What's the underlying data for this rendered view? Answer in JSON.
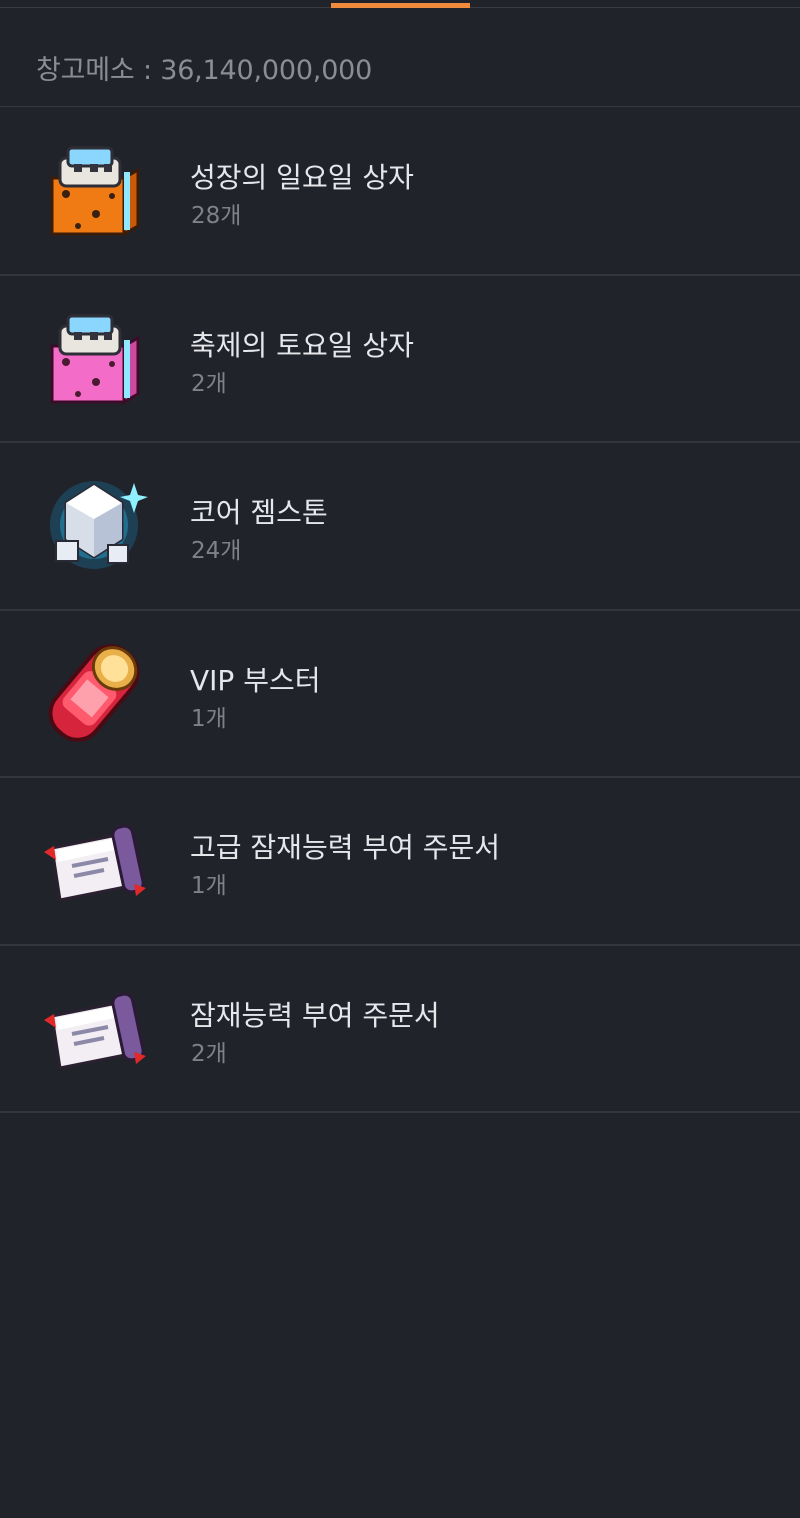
{
  "storage": {
    "meso_label": "창고메소 : 36,140,000,000"
  },
  "items": [
    {
      "name": "성장의 일요일 상자",
      "count": "28개",
      "icon": "sunday-box-icon"
    },
    {
      "name": "축제의 토요일 상자",
      "count": "2개",
      "icon": "saturday-box-icon"
    },
    {
      "name": "코어 젬스톤",
      "count": "24개",
      "icon": "core-gemstone-icon"
    },
    {
      "name": "VIP 부스터",
      "count": "1개",
      "icon": "vip-booster-icon"
    },
    {
      "name": "고급 잠재능력 부여 주문서",
      "count": "1개",
      "icon": "scroll-icon"
    },
    {
      "name": "잠재능력 부여 주문서",
      "count": "2개",
      "icon": "scroll-icon"
    }
  ],
  "colors": {
    "background": "#21232b",
    "accent": "#f08a3c",
    "divider": "#34363e"
  }
}
